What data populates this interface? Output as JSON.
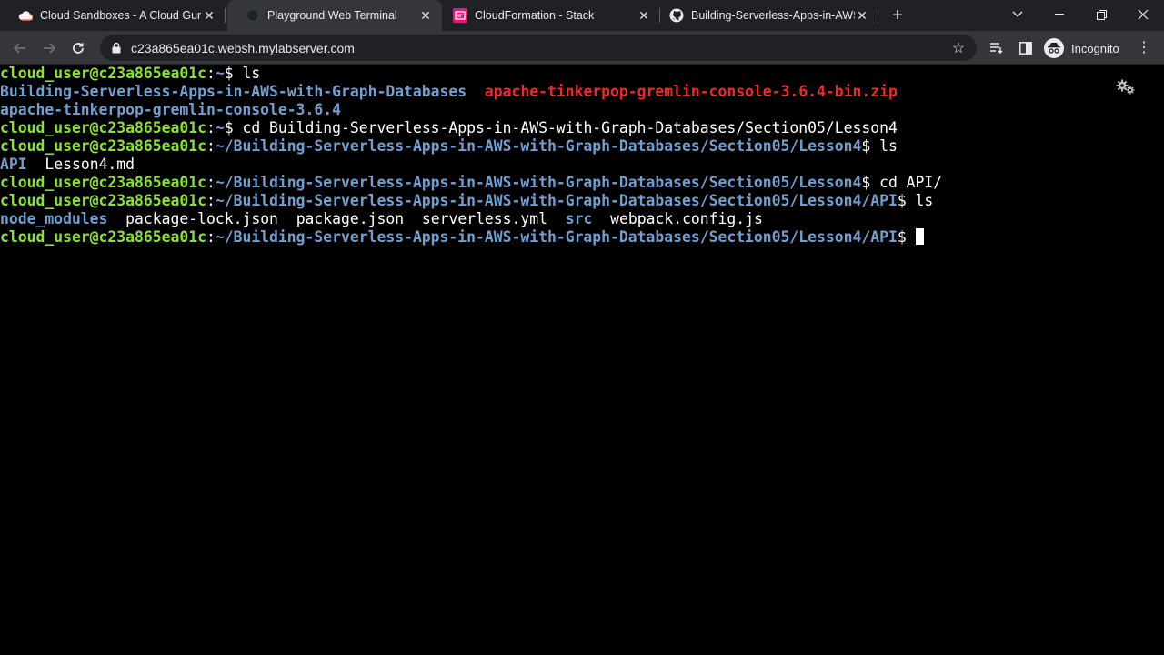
{
  "browser": {
    "tabs": [
      {
        "title": "Cloud Sandboxes - A Cloud Guru",
        "icon": "cloud-icon",
        "active": false
      },
      {
        "title": "Playground Web Terminal",
        "icon": "terminal-icon",
        "active": true
      },
      {
        "title": "CloudFormation - Stack",
        "icon": "cloudformation-icon",
        "active": false
      },
      {
        "title": "Building-Serverless-Apps-in-AWS",
        "icon": "github-icon",
        "active": false
      }
    ],
    "url": "c23a865ea01c.websh.mylabserver.com",
    "profile_label": "Incognito"
  },
  "terminal": {
    "colors": {
      "user": "#8ae234",
      "path": "#729fcf",
      "archive": "#ef2929",
      "text": "#ffffff"
    },
    "lines": [
      {
        "user": "cloud_user@c23a865ea01c",
        "sep": ":",
        "path": "~",
        "cmd": "$ ls"
      },
      {
        "dir1": "Building-Serverless-Apps-in-AWS-with-Graph-Databases",
        "archive1": "apache-tinkerpop-gremlin-console-3.6.4-bin.zip"
      },
      {
        "dir1": "apache-tinkerpop-gremlin-console-3.6.4"
      },
      {
        "user": "cloud_user@c23a865ea01c",
        "sep": ":",
        "path": "~",
        "cmd": "$ cd Building-Serverless-Apps-in-AWS-with-Graph-Databases/Section05/Lesson4"
      },
      {
        "user": "cloud_user@c23a865ea01c",
        "sep": ":",
        "path": "~/Building-Serverless-Apps-in-AWS-with-Graph-Databases/Section05/Lesson4",
        "cmd": "$ ls"
      },
      {
        "dir1": "API",
        "file1": "Lesson4.md"
      },
      {
        "user": "cloud_user@c23a865ea01c",
        "sep": ":",
        "path": "~/Building-Serverless-Apps-in-AWS-with-Graph-Databases/Section05/Lesson4",
        "cmd": "$ cd API/"
      },
      {
        "user": "cloud_user@c23a865ea01c",
        "sep": ":",
        "path": "~/Building-Serverless-Apps-in-AWS-with-Graph-Databases/Section05/Lesson4/API",
        "cmd": "$ ls"
      },
      {
        "dir1": "node_modules",
        "files": [
          "package-lock.json",
          "package.json",
          "serverless.yml"
        ],
        "dir2": "src",
        "file_last": "webpack.config.js"
      },
      {
        "user": "cloud_user@c23a865ea01c",
        "sep": ":",
        "path": "~/Building-Serverless-Apps-in-AWS-with-Graph-Databases/Section05/Lesson4/API",
        "cmd": "$ "
      }
    ]
  }
}
